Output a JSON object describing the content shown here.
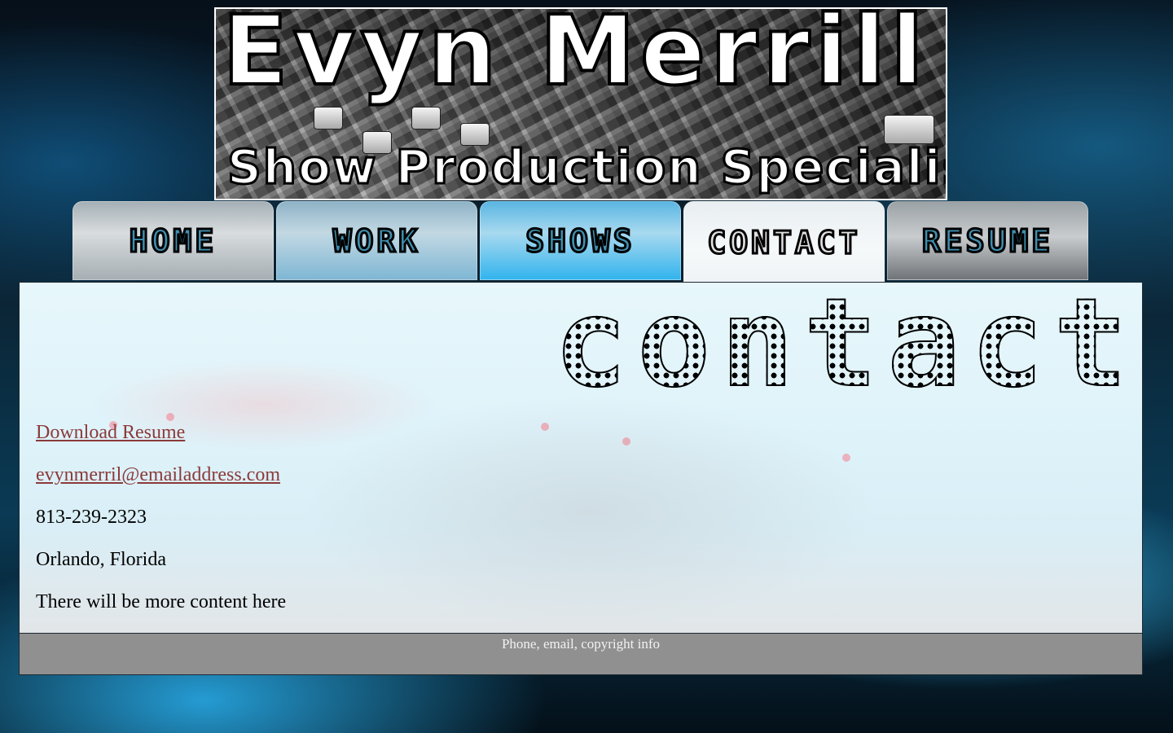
{
  "header": {
    "name": "Evyn Merrill",
    "tagline": "Show Production Specialist"
  },
  "nav": {
    "items": [
      {
        "label": "HOME"
      },
      {
        "label": "WORK"
      },
      {
        "label": "SHOWS"
      },
      {
        "label": "CONTACT",
        "active": true
      },
      {
        "label": "RESUME"
      }
    ]
  },
  "main": {
    "heading": "contact",
    "download_resume": "Download Resume",
    "email": "evynmerril@emailaddress.com",
    "phone": "813-239-2323",
    "location": "Orlando, Florida",
    "note": "There will be more content here"
  },
  "footer": {
    "text": "Phone, email, copyright info"
  },
  "colors": {
    "link": "#8b3a3a",
    "footer_bg": "#909090",
    "active_tab": "#eef3f5"
  }
}
